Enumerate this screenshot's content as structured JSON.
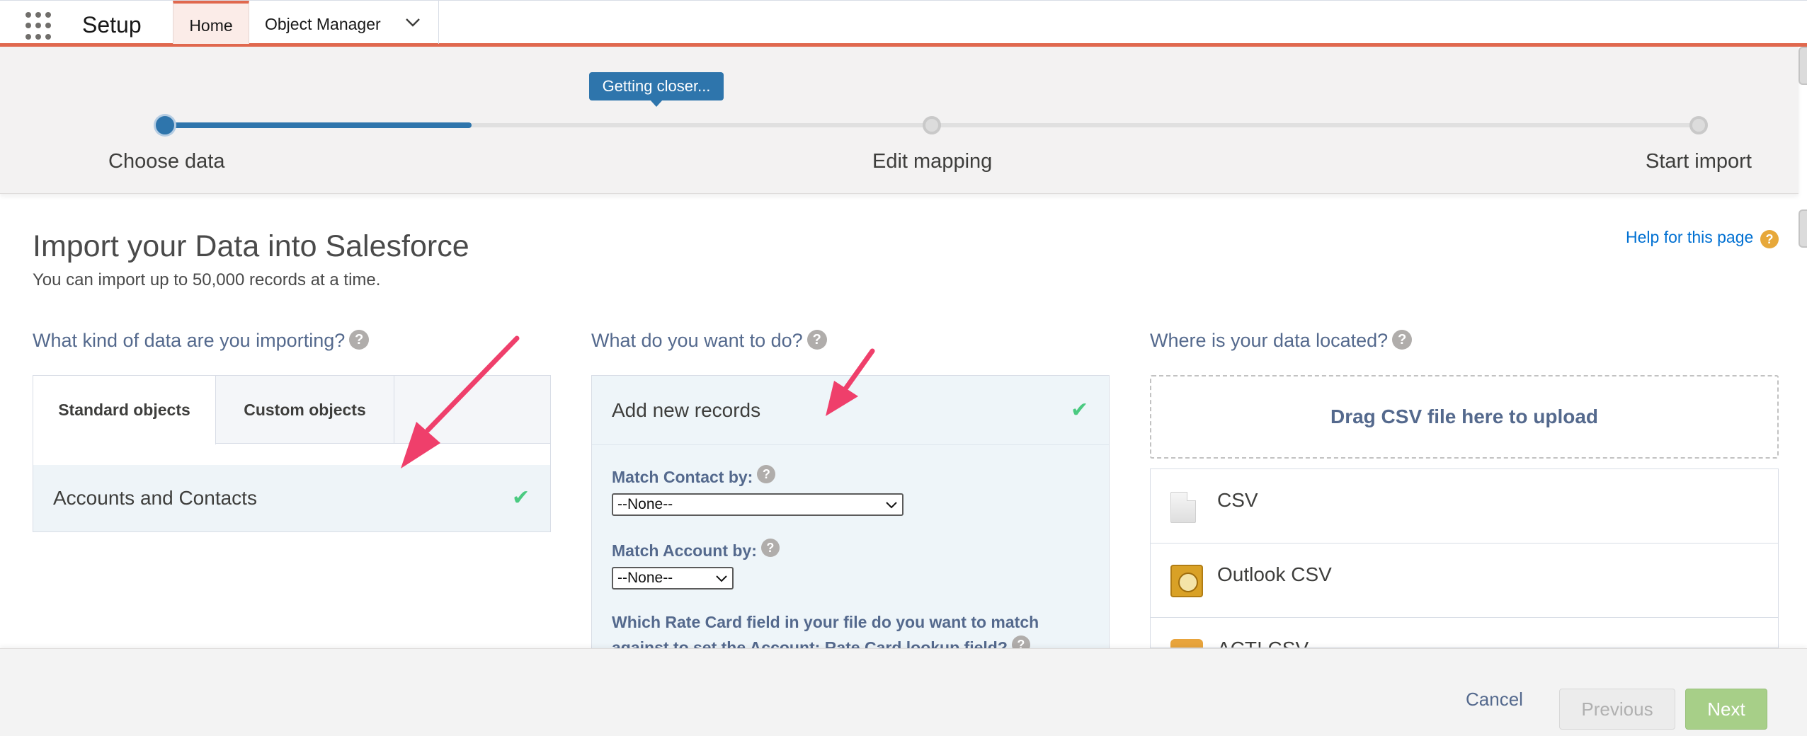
{
  "nav": {
    "app_name": "Setup",
    "tabs": [
      {
        "label": "Home",
        "active": true
      },
      {
        "label": "Object Manager",
        "active": false
      }
    ],
    "accent_color": "#e0684e"
  },
  "progress": {
    "tooltip": "Getting closer...",
    "steps": [
      {
        "label": "Choose data",
        "state": "active"
      },
      {
        "label": "Edit mapping",
        "state": "pending"
      },
      {
        "label": "Start import",
        "state": "pending"
      }
    ],
    "fill_fraction": 0.2
  },
  "main": {
    "title": "Import your Data into Salesforce",
    "subtitle": "You can import up to 50,000 records at a time.",
    "help_link": "Help for this page",
    "help_badge": "?",
    "col1": {
      "heading": "What kind of data are you importing?",
      "tabs": [
        {
          "label": "Standard objects",
          "selected": true
        },
        {
          "label": "Custom objects",
          "selected": false
        }
      ],
      "selected_item": "Accounts and Contacts",
      "check": "✔"
    },
    "col2": {
      "heading": "What do you want to do?",
      "action": "Add new records",
      "check": "✔",
      "match_contact_label": "Match Contact by:",
      "match_contact_value": "--None--",
      "match_account_label": "Match Account by:",
      "match_account_value": "--None--",
      "rate_card_question": "Which Rate Card field in your file do you want to match against to set the Account: Rate Card lookup field?"
    },
    "col3": {
      "heading": "Where is your data located?",
      "drop_label": "Drag CSV file here to upload",
      "sources": [
        {
          "label": "CSV",
          "icon": "file-icon"
        },
        {
          "label": "Outlook CSV",
          "icon": "outlook-icon"
        },
        {
          "label": "ACT! CSV",
          "icon": "act-icon"
        }
      ]
    }
  },
  "footer": {
    "cancel": "Cancel",
    "previous": "Previous",
    "next": "Next"
  },
  "annotation_color": "#ef3f6b"
}
